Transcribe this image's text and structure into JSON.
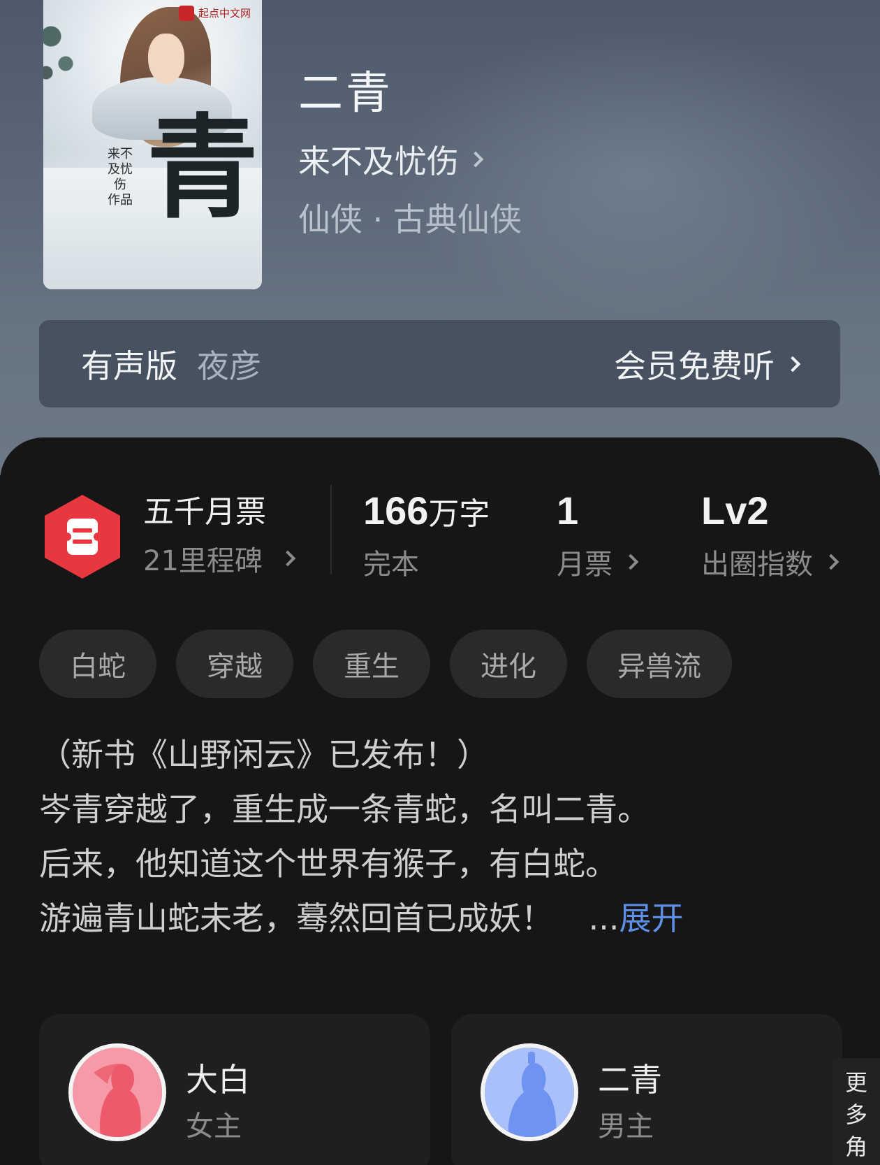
{
  "book": {
    "cover_badge": "起点中文网",
    "cover_title_char": "青",
    "cover_author_vertical": "来不及忧伤 作品",
    "title": "二青",
    "author": "来不及忧伤",
    "genre": "仙侠 · 古典仙侠"
  },
  "audio": {
    "label": "有声版",
    "narrator": "夜彦",
    "cta": "会员免费听"
  },
  "stats": {
    "milestone_title": "五千月票",
    "milestone_sub": "21里程碑",
    "words_value": "166",
    "words_unit": "万字",
    "words_status": "完本",
    "monthly_value": "1",
    "monthly_label": "月票",
    "level_value": "Lv2",
    "level_label": "出圈指数"
  },
  "tags": [
    "白蛇",
    "穿越",
    "重生",
    "进化",
    "异兽流"
  ],
  "description": {
    "line1": "（新书《山野闲云》已发布！）",
    "line2": "岑青穿越了，重生成一条青蛇，名叫二青。",
    "line3": "后来，他知道这个世界有猴子，有白蛇。",
    "line4": "游遍青山蛇未老，蓦然回首已成妖！",
    "ellipsis": "...",
    "expand": "展开"
  },
  "characters": [
    {
      "name": "大白",
      "role": "女主"
    },
    {
      "name": "二青",
      "role": "男主"
    }
  ],
  "more_roles": "更多角",
  "colors": {
    "accent_link": "#5e8fe6",
    "badge_red": "#e8373f",
    "female_avatar": "#f06a78",
    "male_avatar": "#6f93f0"
  }
}
